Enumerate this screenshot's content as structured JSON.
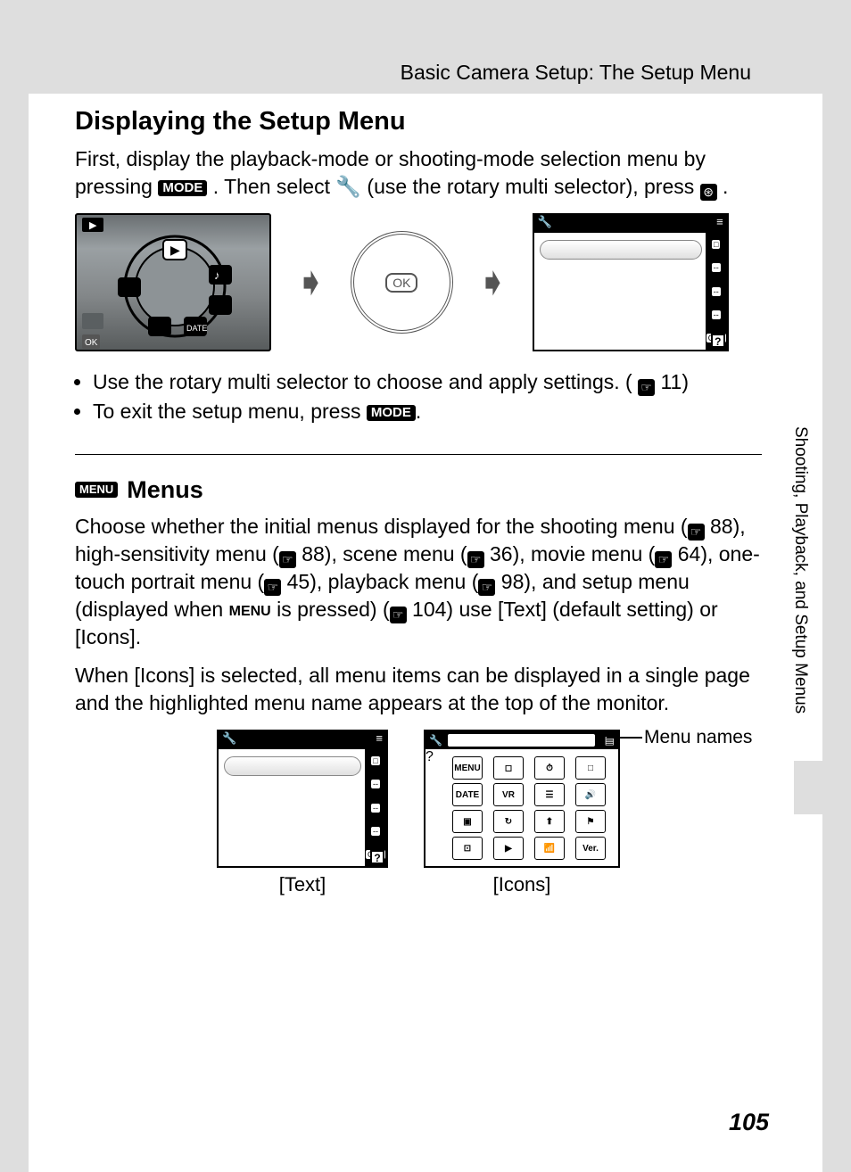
{
  "header": {
    "breadcrumb": "Basic Camera Setup: The Setup Menu"
  },
  "section1": {
    "heading": "Displaying the Setup Menu",
    "intro_part1": "First, display the playback-mode or shooting-mode selection menu by pressing ",
    "intro_mode": "MODE",
    "intro_part2": ". Then select ",
    "intro_part3": " (use the rotary multi selector), press ",
    "intro_part4": ".",
    "ok_button": "OK",
    "bullet1_a": "Use the rotary multi selector to choose and apply settings. (",
    "bullet1_ref": "11",
    "bullet1_b": ")",
    "bullet2_a": "To exit the setup menu, press ",
    "bullet2_mode": "MODE",
    "bullet2_b": "."
  },
  "section2": {
    "menu_icon_label": "MENU",
    "heading": "Menus",
    "para1_a": "Choose whether the initial menus displayed for the shooting menu (",
    "ref_88": "88",
    "para1_b": "), high-sensitivity menu (",
    "para1_c": "), scene menu (",
    "ref_36": "36",
    "para1_d": "), movie menu (",
    "ref_64": "64",
    "para1_e": "), one-touch portrait menu (",
    "ref_45": "45",
    "para1_f": "), playback menu (",
    "ref_98": "98",
    "para1_g": "), and setup menu (displayed when ",
    "para1_h": " is pressed) (",
    "ref_104": "104",
    "para1_i": ") use [Text] (default setting) or [Icons].",
    "para2": "When [Icons] is selected, all menu items can be displayed in a single page and the highlighted menu name appears at the top of the monitor.",
    "text_label": "[Text]",
    "icons_label": "[Icons]",
    "callout": "Menu names"
  },
  "screens": {
    "setup_side_items": [
      "□",
      "--",
      "--",
      "--",
      "OFF"
    ],
    "help": "?",
    "wrench": "🔧",
    "icons_grid": [
      "MENU",
      "◻",
      "⏱",
      "□",
      "DATE",
      "VR",
      "☰",
      "🔊",
      "▣",
      "↻",
      "⬆",
      "⚑",
      "⊡",
      "▶",
      "📶",
      "Ver."
    ]
  },
  "side_tab": "Shooting, Playback, and Setup Menus",
  "page_number": "105"
}
